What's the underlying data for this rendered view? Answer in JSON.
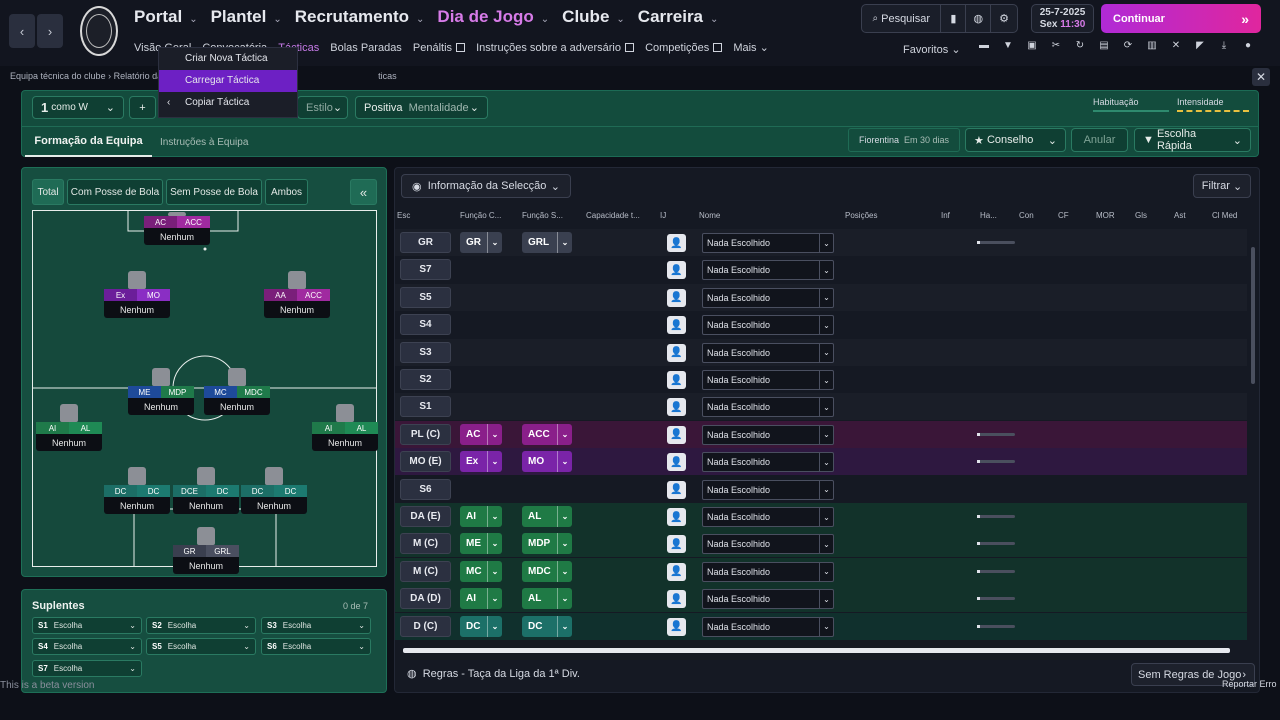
{
  "topbar": {
    "nav": [
      {
        "label": "Portal",
        "color": "#e6e8ee"
      },
      {
        "label": "Plantel",
        "color": "#e6e8ee"
      },
      {
        "label": "Recrutamento",
        "color": "#e6e8ee"
      },
      {
        "label": "Dia de Jogo",
        "color": "#d77be8"
      },
      {
        "label": "Clube",
        "color": "#e6e8ee"
      },
      {
        "label": "Carreira",
        "color": "#e6e8ee"
      }
    ],
    "subnav": [
      "Visão Geral",
      "Convocatória",
      "Tácticas",
      "Bolas Paradas",
      "Penáltis",
      "Instruções sobre a adversário",
      "Competições",
      "Mais"
    ],
    "search_label": "Pesquisar",
    "date": "25-7-2025",
    "day": "Sex",
    "time": "11:30",
    "continue_label": "Continuar",
    "favorites_label": "Favoritos",
    "icons": [
      "message-icon",
      "shirt-icon",
      "board-icon",
      "scissors-icon",
      "refresh-icon",
      "report-icon",
      "sync-icon",
      "document-icon",
      "handshake-icon",
      "megaphone-icon",
      "download-icon",
      "bear-icon"
    ]
  },
  "breadcrumb": {
    "first": "Equipa técnica do clube",
    "second": "Relatório da",
    "third": "ticas"
  },
  "dropdown": {
    "items": [
      "Criar Nova Táctica",
      "Carregar Táctica",
      "Copiar Táctica"
    ],
    "selected": 1
  },
  "tactic": {
    "slot_number": "1",
    "slot_label": "como W",
    "plus": "+",
    "style_label": "Estilo",
    "mentality_value": "Positiva",
    "mentality_label": "Mentalidade",
    "familiarity_label": "Habituação",
    "intensity_label": "Intensidade",
    "tab_formation": "Formação da Equipa",
    "tab_instructions": "Instruções à Equipa",
    "opponent": "Fiorentina",
    "opponent_time": "Em 30 dias",
    "advice_label": "Conselho",
    "cancel_label": "Anular",
    "quick_pick_label": "Escolha Rápida"
  },
  "pitch": {
    "tabs": [
      "Total",
      "Com Posse de Bola",
      "Sem Posse de Bola",
      "Ambos"
    ],
    "collapse": "«",
    "players": [
      {
        "tags": [
          "AC",
          "ACC"
        ],
        "colors": [
          "#7a1f7a",
          "#a02aa0"
        ],
        "name": "Nenhum"
      },
      {
        "tags": [
          "Ex",
          "MO"
        ],
        "colors": [
          "#6b1e9a",
          "#8a2ec4"
        ],
        "name": "Nenhum"
      },
      {
        "tags": [
          "AA",
          "ACC"
        ],
        "colors": [
          "#7a1f7a",
          "#a02aa0"
        ],
        "name": "Nenhum"
      },
      {
        "tags": [
          "ME",
          "MDP"
        ],
        "colors": [
          "#1e4a9a",
          "#1f7a4a"
        ],
        "name": "Nenhum"
      },
      {
        "tags": [
          "MC",
          "MDC"
        ],
        "colors": [
          "#1e4a9a",
          "#1f7a4a"
        ],
        "name": "Nenhum"
      },
      {
        "tags": [
          "AI",
          "AL"
        ],
        "colors": [
          "#1f7a4a",
          "#1f8a55"
        ],
        "name": "Nenhum"
      },
      {
        "tags": [
          "AI",
          "AL"
        ],
        "colors": [
          "#1f7a4a",
          "#1f8a55"
        ],
        "name": "Nenhum"
      },
      {
        "tags": [
          "DC",
          "DC"
        ],
        "colors": [
          "#1c6e66",
          "#1c7a70"
        ],
        "name": "Nenhum"
      },
      {
        "tags": [
          "DCE",
          "DC"
        ],
        "colors": [
          "#1c6e66",
          "#1c7a70"
        ],
        "name": "Nenhum"
      },
      {
        "tags": [
          "DC",
          "DC"
        ],
        "colors": [
          "#1c6e66",
          "#1c7a70"
        ],
        "name": "Nenhum"
      },
      {
        "tags": [
          "GR",
          "GRL"
        ],
        "colors": [
          "#3a3f4f",
          "#4a4f60"
        ],
        "name": "Nenhum"
      }
    ]
  },
  "subs": {
    "title": "Suplentes",
    "count": "0 de 7",
    "items": [
      {
        "slot": "S1",
        "value": "Escolha"
      },
      {
        "slot": "S2",
        "value": "Escolha"
      },
      {
        "slot": "S3",
        "value": "Escolha"
      },
      {
        "slot": "S4",
        "value": "Escolha"
      },
      {
        "slot": "S5",
        "value": "Escolha"
      },
      {
        "slot": "S6",
        "value": "Escolha"
      },
      {
        "slot": "S7",
        "value": "Escolha"
      }
    ]
  },
  "table": {
    "info_label": "Informação da Selecção",
    "filter_label": "Filtrar",
    "headers": [
      "Esc",
      "Função C...",
      "Função S...",
      "Capacidade t...",
      "IJ",
      "Nome",
      "Posições",
      "Inf",
      "Ha...",
      "Con",
      "CF",
      "MOR",
      "Gls",
      "Ast",
      "Cl Med"
    ],
    "rows": [
      {
        "pos": "GR",
        "r1": "GR",
        "r2": "GRL",
        "c1": "#3a4050",
        "c2": "#3a4050",
        "player": "Nada Escolhido",
        "bar": true,
        "hl": ""
      },
      {
        "pos": "S7",
        "r1": "",
        "r2": "",
        "player": "Nada Escolhido",
        "bar": false,
        "hl": ""
      },
      {
        "pos": "S5",
        "r1": "",
        "r2": "",
        "player": "Nada Escolhido",
        "bar": false,
        "hl": ""
      },
      {
        "pos": "S4",
        "r1": "",
        "r2": "",
        "player": "Nada Escolhido",
        "bar": false,
        "hl": ""
      },
      {
        "pos": "S3",
        "r1": "",
        "r2": "",
        "player": "Nada Escolhido",
        "bar": false,
        "hl": ""
      },
      {
        "pos": "S2",
        "r1": "",
        "r2": "",
        "player": "Nada Escolhido",
        "bar": false,
        "hl": ""
      },
      {
        "pos": "S1",
        "r1": "",
        "r2": "",
        "player": "Nada Escolhido",
        "bar": false,
        "hl": ""
      },
      {
        "pos": "PL (C)",
        "r1": "AC",
        "r2": "ACC",
        "c1": "#8a1f8a",
        "c2": "#8a1f8a",
        "player": "Nada Escolhido",
        "bar": true,
        "hl": "#3a1638"
      },
      {
        "pos": "MO (E)",
        "r1": "Ex",
        "r2": "MO",
        "c1": "#7a24a8",
        "c2": "#7a24a8",
        "player": "Nada Escolhido",
        "bar": true,
        "hl": "#2e1840"
      },
      {
        "pos": "S6",
        "r1": "",
        "r2": "",
        "player": "Nada Escolhido",
        "bar": false,
        "hl": ""
      },
      {
        "pos": "DA (E)",
        "r1": "AI",
        "r2": "AL",
        "c1": "#1f7a45",
        "c2": "#1f7a45",
        "player": "Nada Escolhido",
        "bar": true,
        "hl": "#12322a"
      },
      {
        "pos": "M (C)",
        "r1": "ME",
        "r2": "MDP",
        "c1": "#1f7a45",
        "c2": "#1f7a45",
        "player": "Nada Escolhido",
        "bar": true,
        "hl": "#12322a"
      },
      {
        "pos": "M (C)",
        "r1": "MC",
        "r2": "MDC",
        "c1": "#1f7a45",
        "c2": "#1f7a45",
        "player": "Nada Escolhido",
        "bar": true,
        "hl": "#12322a"
      },
      {
        "pos": "DA (D)",
        "r1": "AI",
        "r2": "AL",
        "c1": "#1f7a45",
        "c2": "#1f7a45",
        "player": "Nada Escolhido",
        "bar": true,
        "hl": "#12322a"
      },
      {
        "pos": "D (C)",
        "r1": "DC",
        "r2": "DC",
        "c1": "#1c7068",
        "c2": "#1c7068",
        "player": "Nada Escolhido",
        "bar": true,
        "hl": "#10302d"
      }
    ]
  },
  "footer": {
    "rules": "Regras - Taça da Liga da 1ª Div.",
    "no_rules": "Sem Regras de Jogo",
    "beta": "This is a beta version",
    "report": "Reportar Erro"
  }
}
